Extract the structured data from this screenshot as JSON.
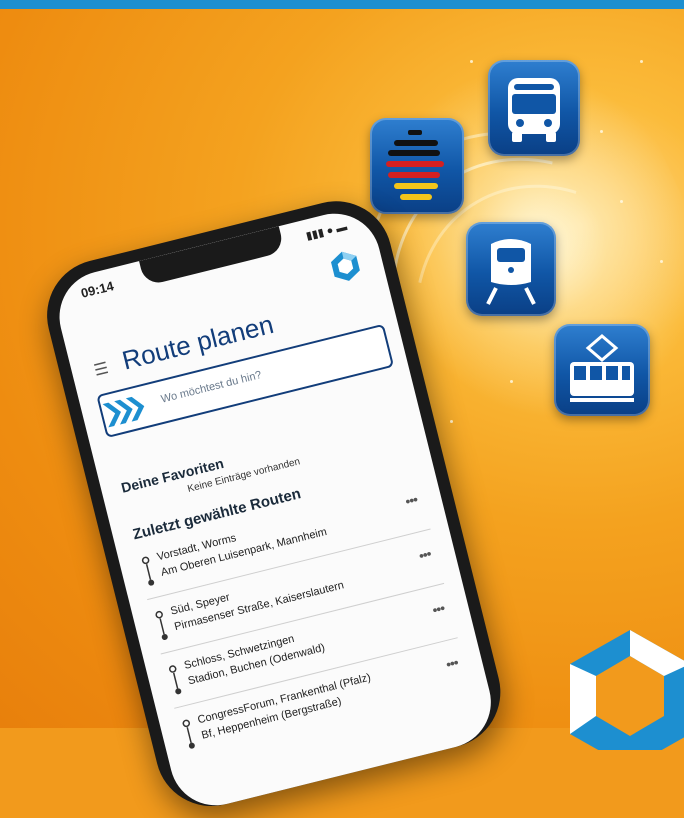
{
  "phone": {
    "status_time": "09:14",
    "status_icons": "▮▮▮ ● ▬",
    "page_title": "Route planen",
    "search_placeholder": "Wo möchtest du hin?",
    "favorites_heading": "Deine Favoriten",
    "favorites_empty": "Keine Einträge vorhanden",
    "recent_heading": "Zuletzt gewählte Routen",
    "routes": [
      {
        "from": "Vorstadt, Worms",
        "to": "Am Oberen Luisenpark, Mannheim",
        "more": "•••"
      },
      {
        "from": "Süd, Speyer",
        "to": "Pirmasenser Straße, Kaiserslautern",
        "more": "•••"
      },
      {
        "from": "Schloss, Schwetzingen",
        "to": "Stadion, Buchen (Odenwald)",
        "more": "•••"
      },
      {
        "from": "CongressForum, Frankenthal (Pfalz)",
        "to": "Bf, Heppenheim (Bergstraße)",
        "more": "•••"
      }
    ]
  },
  "icons": [
    "bus-icon",
    "db-navigator-icon",
    "train-icon",
    "tram-icon"
  ],
  "colors": {
    "accent": "#1d8fd0",
    "navy": "#123d7a",
    "orange": "#f29a1c"
  }
}
